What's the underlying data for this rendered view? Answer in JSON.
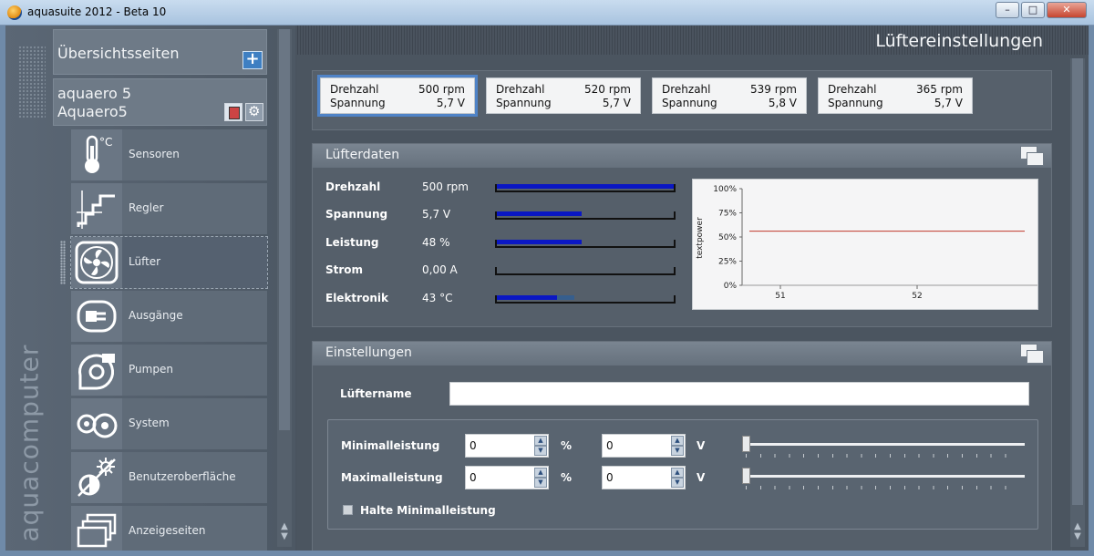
{
  "window": {
    "title": "aquasuite 2012 - Beta 10",
    "minimize": "–",
    "maximize": "□",
    "close": "✕"
  },
  "brand": "aquacomputer",
  "nav": {
    "overview_label": "Übersichtsseiten",
    "add_symbol": "+",
    "device_line1": "aquaero 5",
    "device_line2": "Aquaero5",
    "items": [
      {
        "label": "Sensoren",
        "icon": "thermometer-icon"
      },
      {
        "label": "Regler",
        "icon": "controller-icon"
      },
      {
        "label": "Lüfter",
        "icon": "fan-icon",
        "active": true
      },
      {
        "label": "Ausgänge",
        "icon": "power-plug-icon"
      },
      {
        "label": "Pumpen",
        "icon": "pump-icon"
      },
      {
        "label": "System",
        "icon": "system-icon"
      },
      {
        "label": "Benutzeroberfläche",
        "icon": "brightness-icon"
      },
      {
        "label": "Anzeigeseiten",
        "icon": "pages-icon"
      }
    ],
    "scroll_arrows": "▲\n▼"
  },
  "page_title": "Lüftereinstellungen",
  "fan_tiles": [
    {
      "k1": "Drehzahl",
      "v1": "500 rpm",
      "k2": "Spannung",
      "v2": "5,7 V",
      "selected": true
    },
    {
      "k1": "Drehzahl",
      "v1": "520 rpm",
      "k2": "Spannung",
      "v2": "5,7 V"
    },
    {
      "k1": "Drehzahl",
      "v1": "539 rpm",
      "k2": "Spannung",
      "v2": "5,8 V"
    },
    {
      "k1": "Drehzahl",
      "v1": "365 rpm",
      "k2": "Spannung",
      "v2": "5,7 V"
    }
  ],
  "fan_data": {
    "title": "Lüfterdaten",
    "rows": [
      {
        "label": "Drehzahl",
        "value": "500 rpm",
        "fill": 1.0
      },
      {
        "label": "Spannung",
        "value": "5,7 V",
        "fill": 0.48
      },
      {
        "label": "Leistung",
        "value": "48 %",
        "fill": 0.48
      },
      {
        "label": "Strom",
        "value": "0,00 A",
        "fill": 0.0
      },
      {
        "label": "Elektronik",
        "value": "43 °C",
        "fill": 0.34,
        "fill2": 0.44
      }
    ]
  },
  "chart_data": {
    "type": "line",
    "ylabel": "textpower",
    "ylim": [
      0,
      100
    ],
    "y_ticks": [
      "0%",
      "25%",
      "50%",
      "75%",
      "100%"
    ],
    "x_ticks": [
      "51",
      "52"
    ],
    "series": [
      {
        "values": [
          56,
          56
        ],
        "color": "#c0392b"
      }
    ]
  },
  "settings": {
    "title": "Einstellungen",
    "name_label": "Lüftername",
    "name_value": "",
    "min_label": "Minimalleistung",
    "max_label": "Maximalleistung",
    "min_percent": "0",
    "min_volt": "0",
    "max_percent": "0",
    "max_volt": "0",
    "unit_percent": "%",
    "unit_volt": "V",
    "hold_min_label": "Halte Minimalleistung",
    "spin_up": "▲",
    "spin_down": "▼"
  }
}
